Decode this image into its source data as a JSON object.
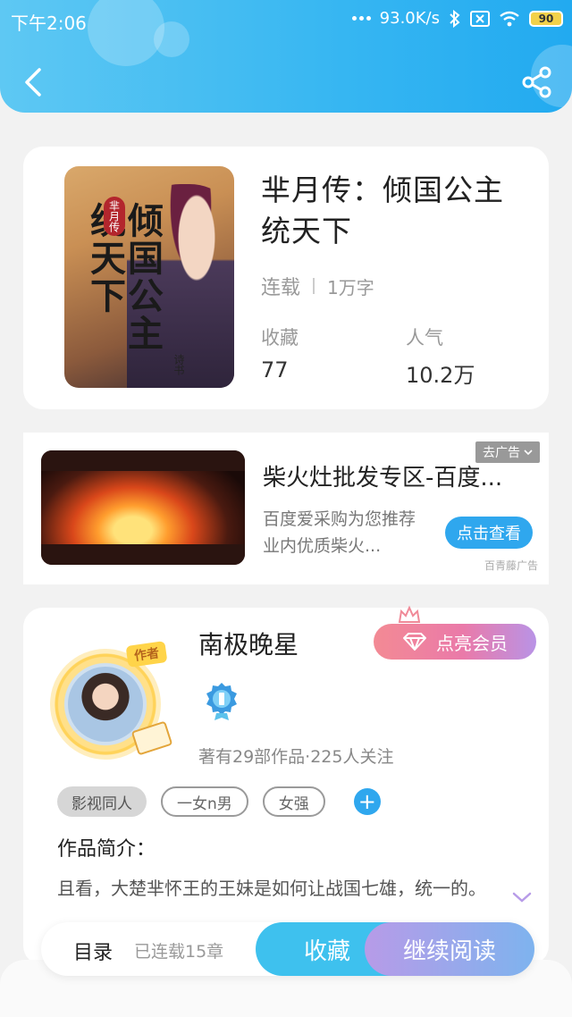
{
  "status_bar": {
    "time": "下午2:06",
    "network_speed": "93.0K/s",
    "battery": "90"
  },
  "book": {
    "title": "芈月传：倾国公主统天下",
    "status": "连载",
    "word_count": "1万字",
    "favorites_label": "收藏",
    "favorites_value": "77",
    "popularity_label": "人气",
    "popularity_value": "10.2万",
    "cover": {
      "title": "倾国公主统天下",
      "series": "芈月传",
      "author": "诗书"
    }
  },
  "ad": {
    "title": "柴火灶批发专区-百度...",
    "description": "百度爱采购为您推荐业内优质柴火...",
    "button": "点击查看",
    "close_label": "去广告",
    "source": "百青藤广告"
  },
  "author": {
    "badge": "作者",
    "name": "南极晚星",
    "vip_button": "点亮会员",
    "stats": "著有29部作品·225人关注",
    "tags": [
      "影视同人",
      "一女n男",
      "女强"
    ],
    "tag_add": "+",
    "intro_title": "作品简介：",
    "intro_text": "且看，大楚芈怀王的王妹是如何让战国七雄，统一的。"
  },
  "bottom_bar": {
    "toc_label": "目录",
    "toc_count": "已连载15章",
    "favorite_button": "收藏",
    "read_button": "继续阅读"
  },
  "colors": {
    "header_blue": "#36b6f2",
    "accent_blue": "#2fa7ee",
    "vip_pink": "#ea7aa9"
  }
}
